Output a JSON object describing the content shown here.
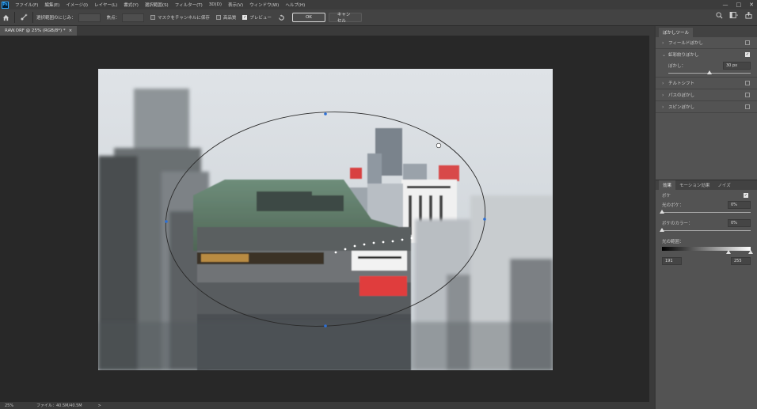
{
  "menubar": {
    "logo": "Ps",
    "items": [
      "ファイル(F)",
      "編集(E)",
      "イメージ(I)",
      "レイヤー(L)",
      "書式(Y)",
      "選択範囲(S)",
      "フィルター(T)",
      "3D(D)",
      "表示(V)",
      "ウィンドウ(W)",
      "ヘルプ(H)"
    ],
    "minimize": "—",
    "maximize": "□",
    "close": "✕"
  },
  "options": {
    "selection_feather_label": "選択範囲のにじみ：",
    "focus_label": "焦点：",
    "save_mask_label": "マスクをチャンネルに保存",
    "high_quality_label": "高品質",
    "preview_label": "プレビュー",
    "ok_label": "OK",
    "cancel_label": "キャンセル"
  },
  "document": {
    "tab_title": "RAW.ORF @ 25% (RGB/8*) *",
    "tab_close": "×",
    "zoom": "25%",
    "file_info": "ファイル：40.5M/40.5M",
    "status_arrow": ">"
  },
  "blur_tools": {
    "tab_label": "ぼかしツール",
    "items": [
      {
        "label": "フィールドぼかし",
        "expanded": false,
        "checked": false
      },
      {
        "label": "虹彩絞りぼかし",
        "expanded": true,
        "checked": true
      },
      {
        "label": "チルトシフト",
        "expanded": false,
        "checked": false
      },
      {
        "label": "パスのぼかし",
        "expanded": false,
        "checked": false
      },
      {
        "label": "スピンぼかし",
        "expanded": false,
        "checked": false
      }
    ],
    "blur_label": "ぼかし：",
    "blur_value": "30 px",
    "blur_level": 0.5
  },
  "effects": {
    "tabs": [
      "効果",
      "モーション効果",
      "ノイズ"
    ],
    "bokeh_label": "ボケ",
    "bokeh_checked": true,
    "light_bokeh_label": "光のボケ：",
    "light_bokeh_value": "0%",
    "light_bokeh_level": 0,
    "bokeh_color_label": "ボケのカラー：",
    "bokeh_color_value": "0%",
    "bokeh_color_level": 0,
    "light_range_label": "光の範囲：",
    "range_min": "191",
    "range_max": "255",
    "range_min_level": 0.75,
    "range_max_level": 1.0
  }
}
